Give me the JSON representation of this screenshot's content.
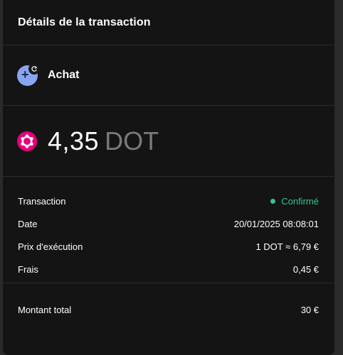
{
  "header": {
    "title": "Détails de la transaction"
  },
  "transaction_type": {
    "label": "Achat",
    "icon": "buy-swap-icon"
  },
  "amount": {
    "value": "4,35",
    "unit": "DOT",
    "asset_icon": "polkadot-icon",
    "asset_color": "#e6007a"
  },
  "details": {
    "rows": [
      {
        "label": "Transaction",
        "value": "Confirmé"
      },
      {
        "label": "Date",
        "value": "20/01/2025 08:08:01"
      },
      {
        "label": "Prix d'exécution",
        "value": "1 DOT ≈ 6,79 €"
      },
      {
        "label": "Frais",
        "value": "0,45 €"
      }
    ],
    "status_color": "#33c19a"
  },
  "total": {
    "label": "Montant total",
    "value": "30 €"
  }
}
